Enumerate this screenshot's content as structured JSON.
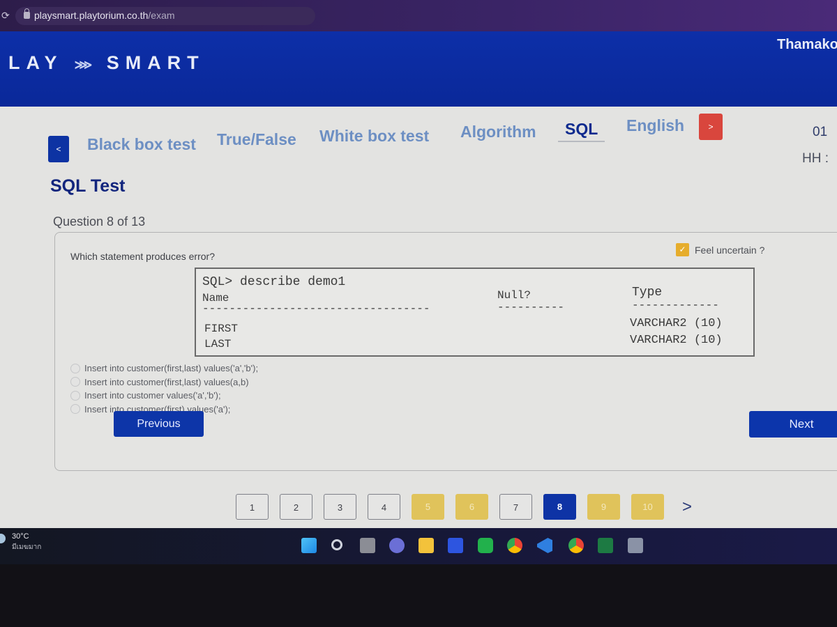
{
  "browser": {
    "url_host": "playsmart.playtorium.co.th",
    "url_path": "/exam"
  },
  "header": {
    "logo_left": "LAY",
    "logo_arrow": "⋙",
    "logo_right": "SMART",
    "user_name": "Thamako"
  },
  "nav": {
    "prev_icon": "<",
    "next_icon": ">",
    "tabs": [
      {
        "label": "Black box test",
        "active": false
      },
      {
        "label": "True/False",
        "active": false
      },
      {
        "label": "White box test",
        "active": false
      },
      {
        "label": "Algorithm",
        "active": false
      },
      {
        "label": "SQL",
        "active": true
      },
      {
        "label": "English",
        "active": false
      }
    ]
  },
  "timer": {
    "value": "01",
    "label": "HH :"
  },
  "section_title": "SQL Test",
  "question_count": "Question 8 of 13",
  "question": {
    "text": "Which statement produces error?",
    "feel_uncertain_label": "Feel uncertain ?",
    "feel_uncertain_checked": true,
    "sql_output": {
      "command": "SQL> describe demo1",
      "col_name": "Name",
      "col_null": "Null?",
      "col_type": "Type",
      "dash_name": "----------------------------------",
      "dash_null": "----------",
      "dash_type": "-------------",
      "rows": [
        {
          "name": "FIRST",
          "type": "VARCHAR2 (10)"
        },
        {
          "name": "LAST",
          "type": "VARCHAR2 (10)"
        }
      ]
    },
    "options": [
      "Insert into customer(first,last) values('a','b');",
      "Insert into customer(first,last) values(a,b)",
      "Insert into customer values('a','b');",
      "Insert into customer(first) values('a');"
    ]
  },
  "buttons": {
    "previous": "Previous",
    "next": "Next"
  },
  "pager": {
    "pages": [
      {
        "label": "1",
        "state": "plain"
      },
      {
        "label": "2",
        "state": "plain"
      },
      {
        "label": "3",
        "state": "plain"
      },
      {
        "label": "4",
        "state": "plain"
      },
      {
        "label": "5",
        "state": "answered"
      },
      {
        "label": "6",
        "state": "answered"
      },
      {
        "label": "7",
        "state": "plain"
      },
      {
        "label": "8",
        "state": "current"
      },
      {
        "label": "9",
        "state": "answered"
      },
      {
        "label": "10",
        "state": "answered"
      }
    ],
    "next_icon": ">"
  },
  "taskbar": {
    "weather_temp": "30°C",
    "weather_desc": "มีเมฆมาก",
    "icons": [
      "windows-start-icon",
      "search-icon",
      "task-view-icon",
      "teams-chat-icon",
      "file-explorer-icon",
      "app-icon",
      "line-icon",
      "chrome-icon",
      "vscode-icon",
      "chrome-profile-icon",
      "excel-icon",
      "calculator-icon"
    ]
  }
}
